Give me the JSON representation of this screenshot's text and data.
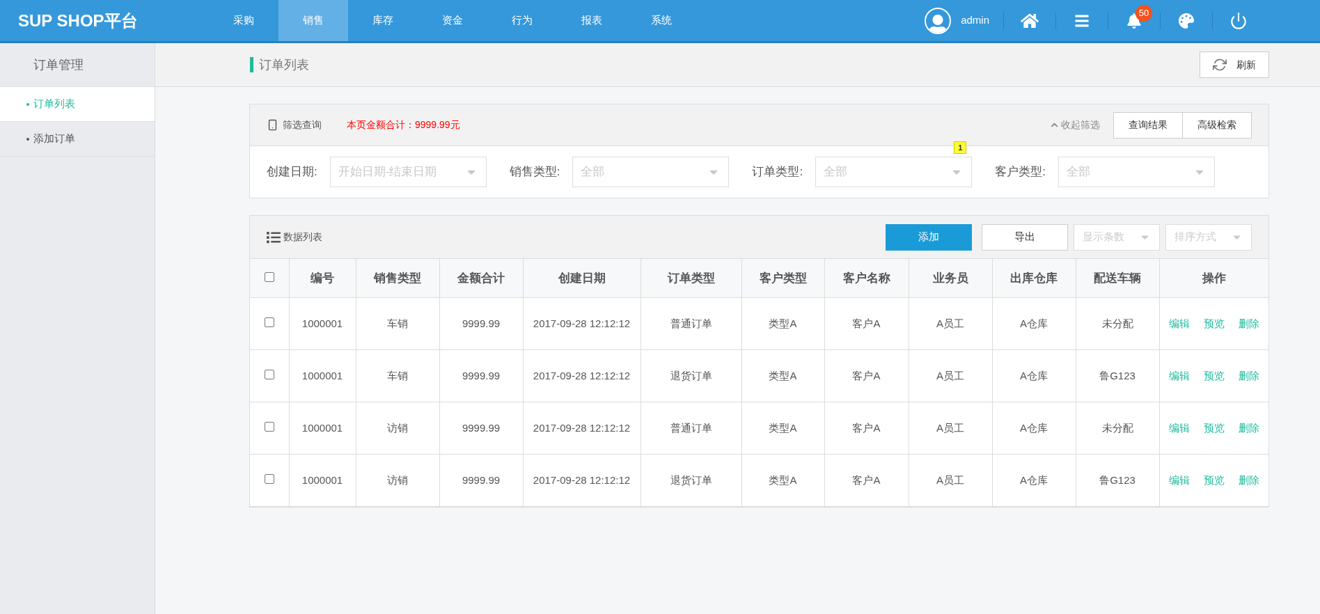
{
  "brand": "SUP SHOP平台",
  "nav": [
    {
      "label": "采购",
      "selected": false
    },
    {
      "label": "销售",
      "selected": true
    },
    {
      "label": "库存",
      "selected": false
    },
    {
      "label": "资金",
      "selected": false
    },
    {
      "label": "行为",
      "selected": false
    },
    {
      "label": "报表",
      "selected": false
    },
    {
      "label": "系统",
      "selected": false
    }
  ],
  "user": {
    "name": "admin"
  },
  "notifications": {
    "count": "50"
  },
  "sidebar": {
    "title": "订单管理",
    "items": [
      {
        "label": "订单列表",
        "selected": true
      },
      {
        "label": "添加订单",
        "selected": false
      }
    ]
  },
  "page": {
    "title": "订单列表",
    "refresh": "刷新"
  },
  "filter": {
    "title": "筛选查询",
    "total": "本页金额合计：9999.99元",
    "collapse": "收起筛选",
    "buttons": [
      "查询结果",
      "高级检索"
    ],
    "fields": [
      {
        "label": "创建日期:",
        "placeholder": "开始日期-结束日期"
      },
      {
        "label": "销售类型:",
        "placeholder": "全部"
      },
      {
        "label": "订单类型:",
        "placeholder": "全部",
        "badge": "1"
      },
      {
        "label": "客户类型:",
        "placeholder": "全部"
      }
    ]
  },
  "data": {
    "title": "数据列表",
    "add": "添加",
    "export": "导出",
    "selects": [
      "显示条数",
      "排序方式"
    ],
    "columns": [
      "编号",
      "销售类型",
      "金额合计",
      "创建日期",
      "订单类型",
      "客户类型",
      "客户名称",
      "业务员",
      "出库仓库",
      "配送车辆",
      "操作"
    ],
    "all_checked": false,
    "rows": [
      {
        "checked": false,
        "cells": [
          "1000001",
          "车销",
          "9999.99",
          "2017-09-28 12:12:12",
          "普通订单",
          "类型A",
          "客户A",
          "A员工",
          "A仓库",
          "未分配"
        ],
        "actions": [
          "编辑",
          "预览",
          "删除"
        ]
      },
      {
        "checked": false,
        "cells": [
          "1000001",
          "车销",
          "9999.99",
          "2017-09-28 12:12:12",
          "退货订单",
          "类型A",
          "客户A",
          "A员工",
          "A仓库",
          "鲁G123"
        ],
        "actions": [
          "编辑",
          "预览",
          "删除"
        ]
      },
      {
        "checked": false,
        "cells": [
          "1000001",
          "访销",
          "9999.99",
          "2017-09-28 12:12:12",
          "普通订单",
          "类型A",
          "客户A",
          "A员工",
          "A仓库",
          "未分配"
        ],
        "actions": [
          "编辑",
          "预览",
          "删除"
        ]
      },
      {
        "checked": false,
        "cells": [
          "1000001",
          "访销",
          "9999.99",
          "2017-09-28 12:12:12",
          "退货订单",
          "类型A",
          "客户A",
          "A员工",
          "A仓库",
          "鲁G123"
        ],
        "actions": [
          "编辑",
          "预览",
          "删除"
        ]
      }
    ]
  }
}
